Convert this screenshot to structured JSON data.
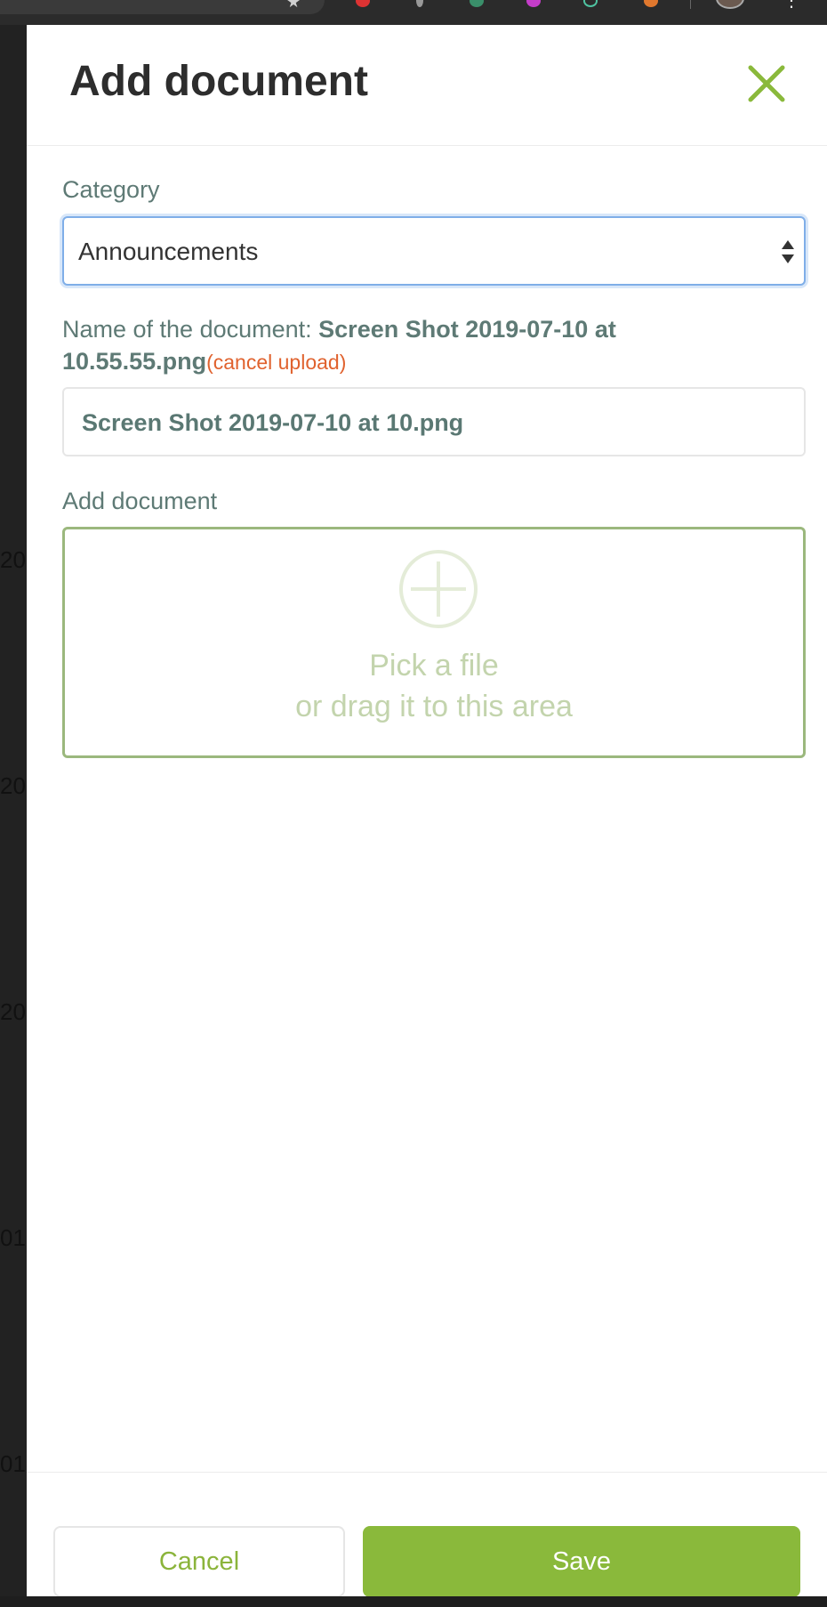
{
  "modal": {
    "title": "Add document",
    "close_icon": "close-icon",
    "accent_color": "#8ab93b"
  },
  "category": {
    "label": "Category",
    "selected": "Announcements"
  },
  "document_name": {
    "label_prefix": "Name of the document: ",
    "file_name": "Screen Shot 2019-07-10 at 10.55.55.png",
    "cancel_upload": "(cancel upload)",
    "input_value": "Screen Shot 2019-07-10 at 10.png"
  },
  "upload": {
    "label": "Add document",
    "icon": "plus-circle-icon",
    "line1": "Pick a file",
    "line2": "or drag it to this area"
  },
  "footer": {
    "cancel_label": "Cancel",
    "save_label": "Save"
  },
  "background_page": {
    "fragments": [
      "20",
      "20",
      "20",
      "01",
      "01"
    ]
  }
}
